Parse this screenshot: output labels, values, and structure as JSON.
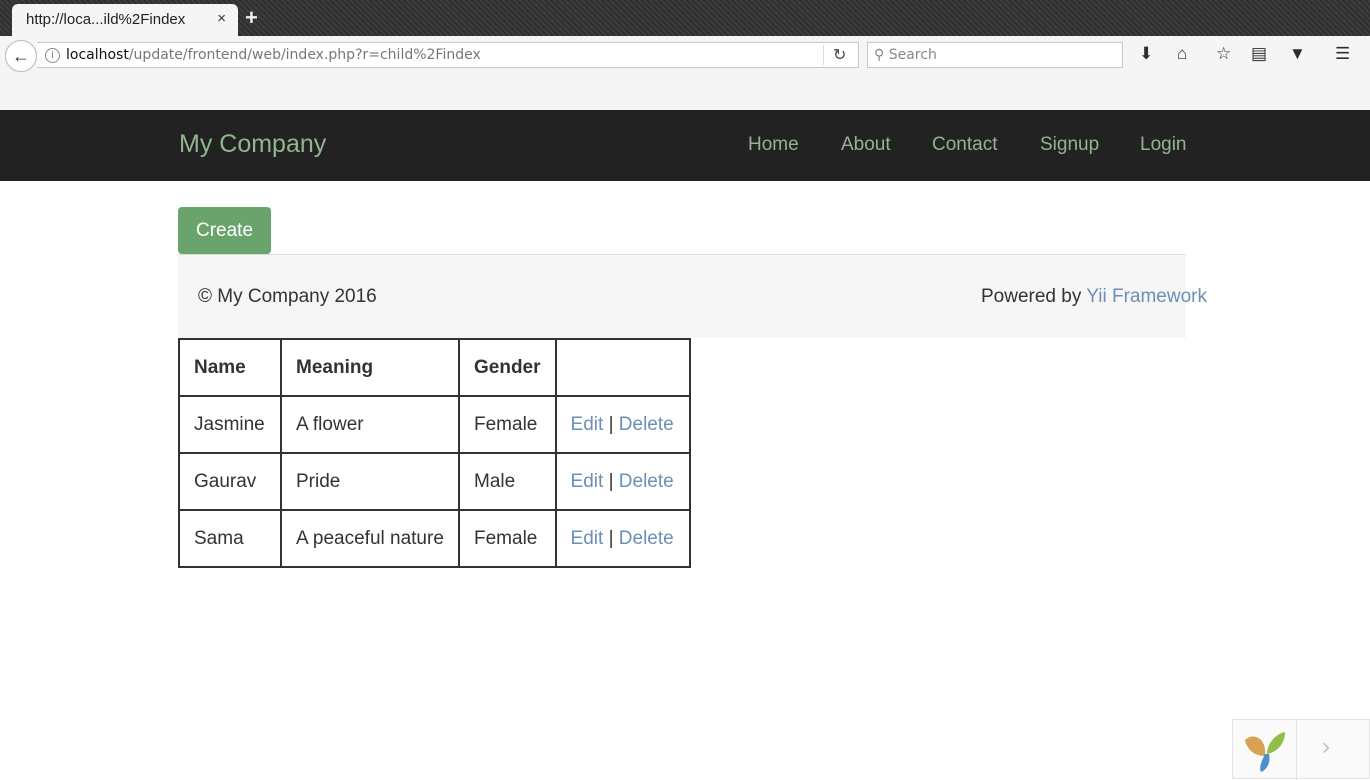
{
  "browser": {
    "tab_title": "http://loca...ild%2Findex",
    "tab_close": "×",
    "new_tab": "+",
    "url_host": "localhost",
    "url_path": "/update/frontend/web/index.php?r=child%2Findex",
    "search_placeholder": "Search",
    "icons": [
      "back-arrow-icon",
      "info-icon",
      "reload-icon",
      "search-icon",
      "download-icon",
      "home-icon",
      "star-icon",
      "reading-list-icon",
      "pocket-icon",
      "menu-icon"
    ]
  },
  "site": {
    "brand": "My Company",
    "nav": [
      "Home",
      "About",
      "Contact",
      "Signup",
      "Login"
    ]
  },
  "page": {
    "create_label": "Create",
    "copyright": "© My Company 2016",
    "powered_by": "Powered by",
    "framework_link": "Yii Framework"
  },
  "table": {
    "headers": [
      "Name",
      "Meaning",
      "Gender",
      ""
    ],
    "rows": [
      {
        "name": "Jasmine",
        "meaning": "A flower",
        "gender": "Female"
      },
      {
        "name": "Gaurav",
        "meaning": "Pride",
        "gender": "Male"
      },
      {
        "name": "Sama",
        "meaning": "A peaceful nature",
        "gender": "Female"
      }
    ],
    "edit_label": "Edit",
    "separator": "|",
    "delete_label": "Delete"
  },
  "widget": {
    "next": "›",
    "icon": "yii-logo"
  },
  "colors": {
    "navbar_bg": "#222222",
    "nav_link": "#92b58f",
    "create_btn": "#6aa36c",
    "link": "#6b8fb5"
  }
}
